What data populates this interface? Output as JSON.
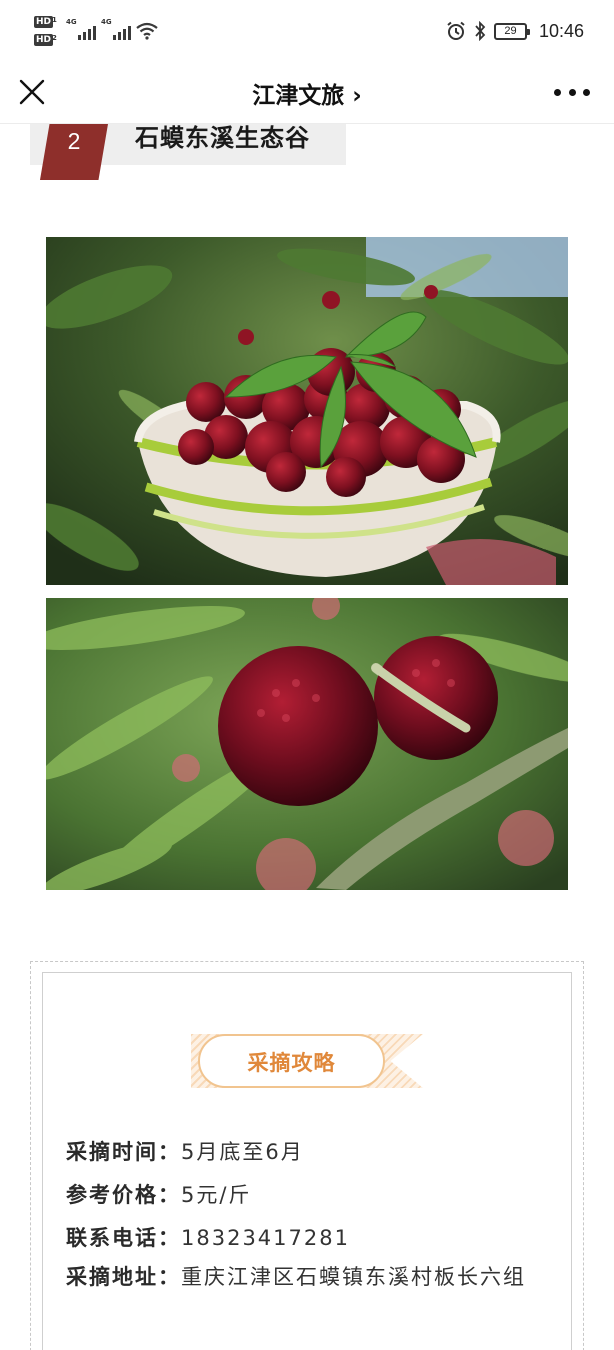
{
  "status_bar": {
    "sim1": "HD",
    "sim2": "HD",
    "sim1_sub": "1",
    "sim2_sub": "2",
    "network1": "4G",
    "network2": "4G",
    "battery": "29",
    "time": "10:46"
  },
  "navbar": {
    "title": "江津文旅 ›",
    "close_icon": "close-icon",
    "more_icon": "more-icon"
  },
  "section": {
    "number": "2",
    "title": "石蟆东溪生态谷"
  },
  "photos": [
    {
      "name": "bayberries-in-basket-photo"
    },
    {
      "name": "bayberries-on-branch-photo"
    }
  ],
  "card": {
    "badge": "采摘攻略",
    "rows": [
      {
        "label": "采摘时间：",
        "value": "5月底至6月"
      },
      {
        "label": "参考价格：",
        "value": "5元/斤"
      },
      {
        "label": "联系电话：",
        "value": "18323417281"
      },
      {
        "label": "采摘地址：",
        "value": "重庆江津区石蟆镇东溪村板长六组"
      }
    ]
  },
  "colors": {
    "accent_red": "#8e2f2b",
    "badge_orange": "#e0883a",
    "badge_border": "#f1c48f"
  }
}
